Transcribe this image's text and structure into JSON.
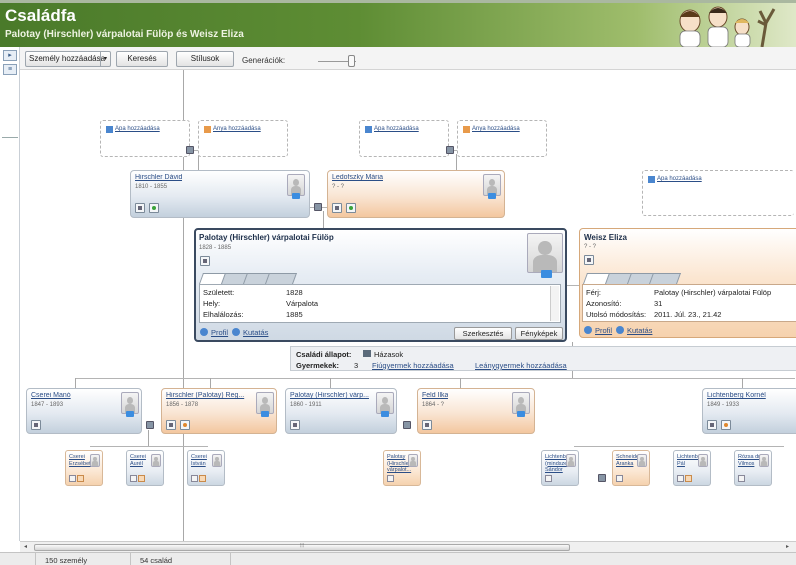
{
  "header": {
    "title": "Családfa",
    "subtitle": "Palotay (Hirschler) várpalotai Fülöp és Weisz Eliza"
  },
  "toolbar": {
    "add_person": "Személy hozzáadása",
    "search": "Keresés",
    "styles": "Stílusok",
    "generations": "Generációk:"
  },
  "add_links": {
    "add_father": "Apa hozzáadása",
    "add_mother": "Anya hozzáadása"
  },
  "grandparents": {
    "father": {
      "name": "Hirschler Dávid",
      "dates": "1810 - 1855"
    },
    "mother": {
      "name": "Ledofszky Mária",
      "dates": "? - ?"
    }
  },
  "selected_person": {
    "name": "Palotay (Hirschler) várpalotai Fülöp",
    "dates": "1828 - 1885",
    "fields": [
      {
        "label": "Született:",
        "value": "1828"
      },
      {
        "label": "Hely:",
        "value": "Várpalota"
      },
      {
        "label": "Elhalálozás:",
        "value": "1885"
      }
    ],
    "links": {
      "profile": "Profil",
      "research": "Kutatás"
    },
    "buttons": {
      "edit": "Szerkesztés",
      "photos": "Fényképek"
    }
  },
  "spouse": {
    "name": "Weisz Eliza",
    "dates": "? - ?",
    "fields": [
      {
        "label": "Férj:",
        "value": "Palotay (Hirschler) várpalotai Fülöp"
      },
      {
        "label": "Azonosító:",
        "value": "31"
      },
      {
        "label": "Utolsó módosítás:",
        "value": "2011. Júl. 23., 21.42"
      }
    ],
    "links": {
      "profile": "Profil",
      "research": "Kutatás"
    }
  },
  "family": {
    "status_label": "Családi állapot:",
    "status_value": "Házasok",
    "children_label": "Gyermekek:",
    "children_count": "3",
    "add_son": "Fiúgyermek hozzáadása",
    "add_daughter": "Leánygyermek hozzáadása"
  },
  "children": [
    {
      "name": "Cserei Manó",
      "dates": "1847 - 1893"
    },
    {
      "name": "Hirschler (Palotay) Reg...",
      "dates": "1856 - 1878"
    },
    {
      "name": "Palotay (Hirschler) várp...",
      "dates": "1860 - 1911"
    },
    {
      "name": "Feld Ilka",
      "dates": "1864 - ?"
    },
    {
      "name": "Lichtenberg Kornél",
      "dates": "1849 - 1933"
    }
  ],
  "grandchildren": [
    {
      "name": "Cserei Erzsébet"
    },
    {
      "name": "Cserei Aurél"
    },
    {
      "name": "Cserei István"
    },
    {
      "name": "Palotay (Hirschler) várpalot..."
    },
    {
      "name": "Lichtenb... (mindsze... Sándor"
    },
    {
      "name": "Schneider Aranka"
    },
    {
      "name": "Lichtenb... Pál"
    },
    {
      "name": "Rózsa dr Vilmos"
    }
  ],
  "scrollbar": {
    "grip": "⦙⦙⦙",
    "left_arrow": "◂",
    "right_arrow": "▸"
  },
  "status": {
    "persons": "150 személy",
    "families": "54 család"
  }
}
